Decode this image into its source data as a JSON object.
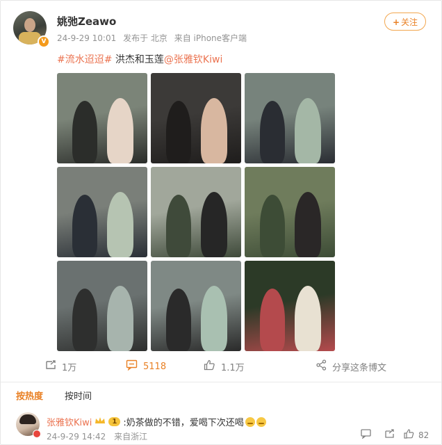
{
  "post": {
    "username": "姚弛Zeawo",
    "timestamp": "24-9-29 10:01",
    "published_from": "发布于 北京",
    "source": "来自 iPhone客户端",
    "follow_label": "关注",
    "text": {
      "hashtag": "#流水迢迢#",
      "body": " 洪杰和玉莲",
      "mention": "@张雅钦Kiwi"
    }
  },
  "images": [
    {
      "colors": [
        "#7b8478",
        "#2b2d2a",
        "#e6d5c7"
      ]
    },
    {
      "colors": [
        "#3c3a38",
        "#1f1d1c",
        "#d8b7a0"
      ]
    },
    {
      "colors": [
        "#77837c",
        "#2a2d33",
        "#a4b7a6"
      ]
    },
    {
      "colors": [
        "#7a7f79",
        "#2a2f36",
        "#b6c4b2"
      ]
    },
    {
      "colors": [
        "#a1a79b",
        "#3f4a3a",
        "#262626"
      ]
    },
    {
      "colors": [
        "#6f7c5c",
        "#3d4c36",
        "#2a2727"
      ]
    },
    {
      "colors": [
        "#6a7170",
        "#2e2f2e",
        "#a7b4ad"
      ]
    },
    {
      "colors": [
        "#7f8985",
        "#2a2a2a",
        "#a9c0b1"
      ]
    },
    {
      "colors": [
        "#2c3a27",
        "#b44a4d",
        "#e8e1d2"
      ]
    }
  ],
  "actions": {
    "share_count": "1万",
    "comment_count": "5118",
    "like_count": "1.1万",
    "share_to_label": "分享这条博文"
  },
  "sort": {
    "hot": "按热度",
    "time": "按时间"
  },
  "comment": {
    "name": "张雅钦Kiwi",
    "level": "1",
    "text": ":奶茶做的不错，爱喝下次还喝",
    "timestamp": "24-9-29 14:42",
    "location": "来自浙江",
    "like_count": "82"
  },
  "colors": {
    "accent": "#e98024",
    "link": "#eb7350",
    "meta": "#939393"
  },
  "icons": [
    "verified-badge-icon",
    "plus-icon",
    "repost-icon",
    "comment-icon",
    "like-icon",
    "share-icon",
    "crown-icon",
    "reply-icon",
    "thumb-icon"
  ]
}
